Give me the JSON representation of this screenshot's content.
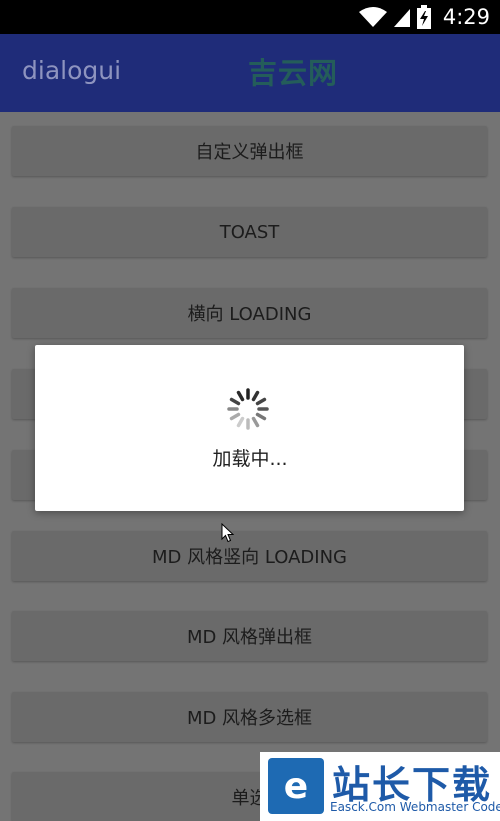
{
  "status_bar": {
    "time": "4:29",
    "icons": [
      "wifi-icon",
      "signal-icon",
      "battery-icon"
    ]
  },
  "app_bar": {
    "title": "dialogui",
    "watermark": "吉云网"
  },
  "buttons": [
    "自定义弹出框",
    "TOAST",
    "横向 LOADING",
    "",
    "",
    "MD 风格竖向 LOADING",
    "MD 风格弹出框",
    "MD 风格多选框",
    "单选"
  ],
  "dialog": {
    "message": "加载中..."
  },
  "watermark": {
    "logo_letter": "e",
    "cn": "站长下载",
    "en": "Easck.Com Webmaster Codes"
  },
  "colors": {
    "app_bar": "#1f2c79",
    "dim_background": "#747474",
    "button": "#6a6a6a",
    "dialog": "#ffffff"
  }
}
